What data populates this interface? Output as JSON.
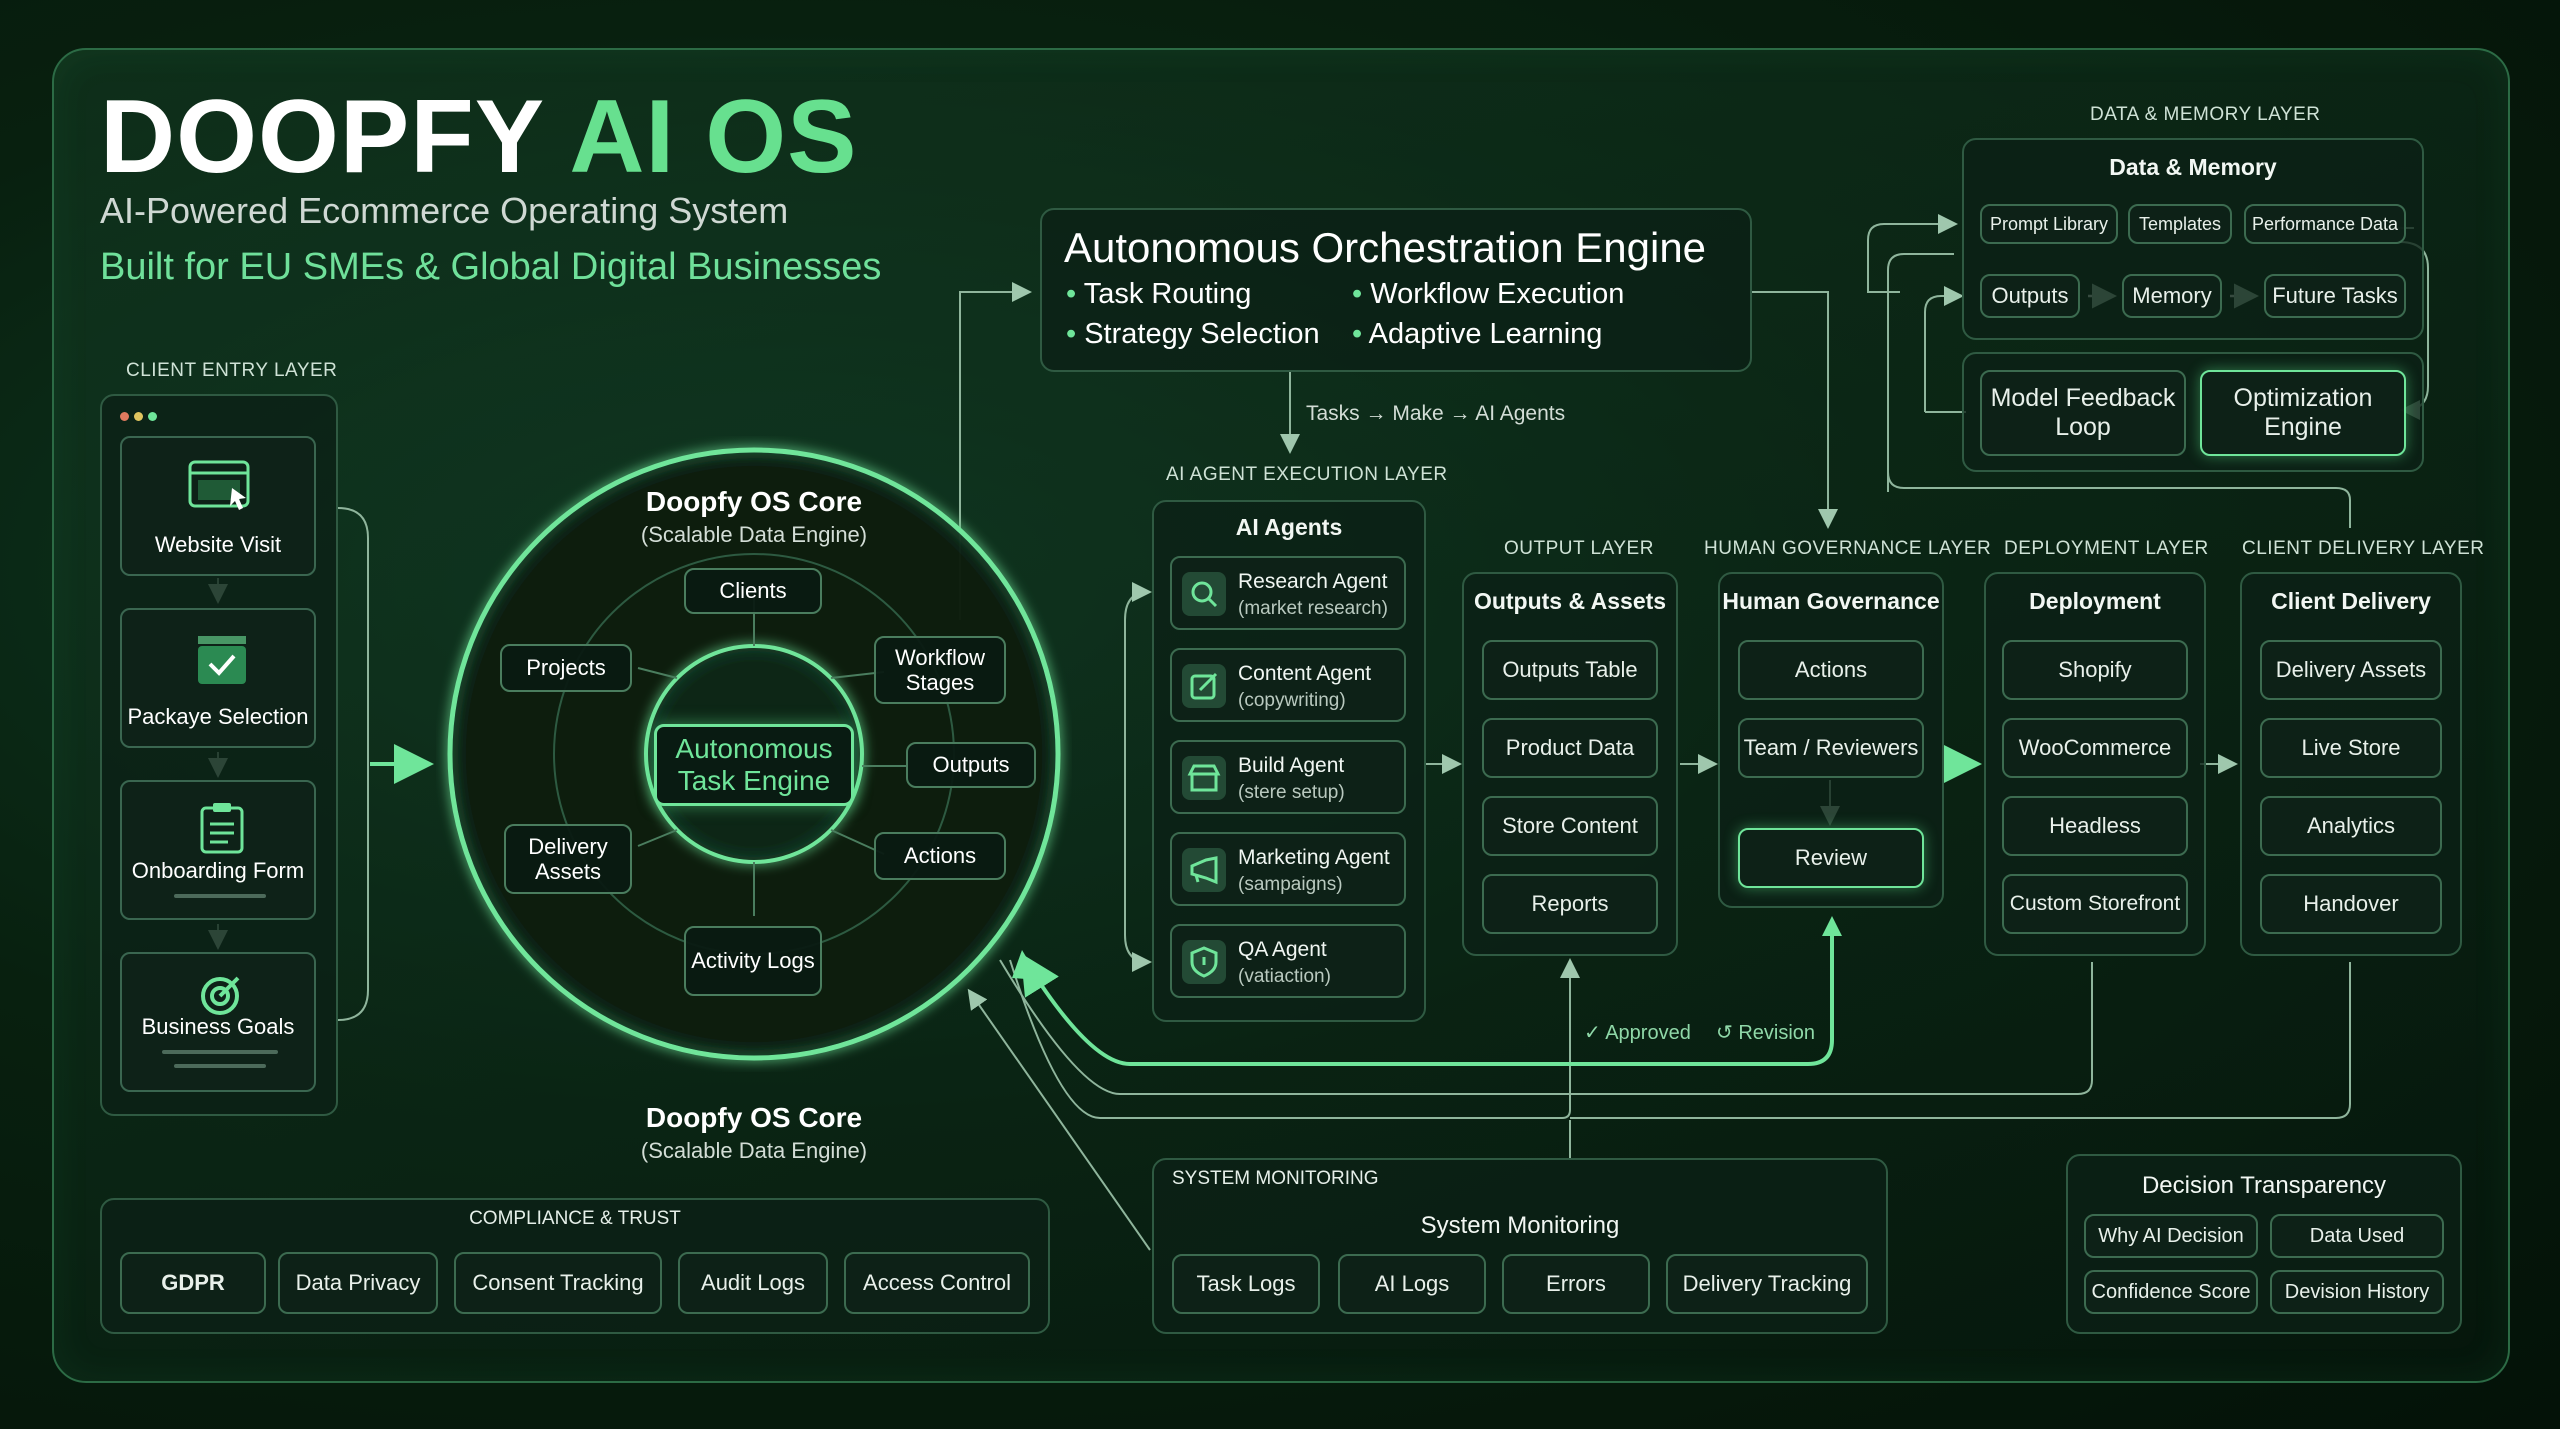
{
  "header": {
    "title_white": "DOOPFY",
    "title_green": "AI OS",
    "subtitle": "AI-Powered Ecommerce Operating System",
    "tagline": "Built for EU SMEs & Global Digital Businesses"
  },
  "client_entry": {
    "layer_label": "CLIENT ENTRY LAYER",
    "items": [
      {
        "label": "Website Visit",
        "icon": "browser-icon"
      },
      {
        "label": "Packaye Selection",
        "icon": "package-check-icon"
      },
      {
        "label": "Onboarding Form",
        "icon": "clipboard-icon"
      },
      {
        "label": "Business Goals",
        "icon": "target-icon"
      }
    ]
  },
  "core": {
    "title": "Doopfy OS Core",
    "subtitle": "(Scalable Data Engine)",
    "center": "Autonomous Task Engine",
    "nodes": [
      "Clients",
      "Workflow Stages",
      "Outputs",
      "Actions",
      "Activity Logs",
      "Delivery Assets",
      "Projects"
    ],
    "bottom_title": "Doopfy OS Core",
    "bottom_subtitle": "(Scalable Data Engine)"
  },
  "orchestration": {
    "title": "Autonomous Orchestration Engine",
    "bullets": [
      "Task Routing",
      "Workflow Execution",
      "Strategy Selection",
      "Adaptive Learning"
    ],
    "flow_label": "Tasks → Make → AI Agents"
  },
  "agents": {
    "layer_label": "AI AGENT EXECUTION LAYER",
    "title": "AI Agents",
    "items": [
      {
        "name": "Research Agent",
        "sub": "(market research)",
        "icon": "search-icon"
      },
      {
        "name": "Content Agent",
        "sub": "(copywriting)",
        "icon": "edit-icon"
      },
      {
        "name": "Build Agent",
        "sub": "(stere setup)",
        "icon": "store-icon"
      },
      {
        "name": "Marketing Agent",
        "sub": "(sampaigns)",
        "icon": "megaphone-icon"
      },
      {
        "name": "QA Agent",
        "sub": "(vatiaction)",
        "icon": "shield-icon"
      }
    ]
  },
  "output_layer": {
    "layer_label": "OUTPUT LAYER",
    "title": "Outputs & Assets",
    "items": [
      "Outputs Table",
      "Product Data",
      "Store Content",
      "Reports"
    ]
  },
  "governance": {
    "layer_label": "HUMAN GOVERNANCE LAYER",
    "title": "Human Governance",
    "items": [
      "Actions",
      "Team / Reviewers",
      "Review"
    ],
    "approved": "Approved",
    "revision": "Revision"
  },
  "deployment": {
    "layer_label": "DEPLOYMENT LAYER",
    "title": "Deployment",
    "items": [
      "Shopify",
      "WooCommerce",
      "Headless",
      "Custom Storefront"
    ]
  },
  "client_delivery": {
    "layer_label": "CLIENT DELIVERY LAYER",
    "title": "Client Delivery",
    "items": [
      "Delivery Assets",
      "Live Store",
      "Analytics",
      "Handover"
    ]
  },
  "data_memory": {
    "layer_label": "DATA & MEMORY LAYER",
    "title": "Data & Memory",
    "row1": [
      "Prompt Library",
      "Templates",
      "Performance Data"
    ],
    "row2": [
      "Outputs",
      "Memory",
      "Future Tasks"
    ],
    "row3": [
      "Model Feedback Loop",
      "Optimization Engine"
    ]
  },
  "compliance": {
    "title": "COMPLIANCE & TRUST",
    "items": [
      "GDPR",
      "Data Privacy",
      "Consent Tracking",
      "Audit Logs",
      "Access Control"
    ]
  },
  "monitoring": {
    "layer_label": "SYSTEM MONITORING",
    "title": "System Monitoring",
    "items": [
      "Task Logs",
      "AI Logs",
      "Errors",
      "Delivery Tracking"
    ]
  },
  "transparency": {
    "title": "Decision Transparency",
    "items": [
      "Why AI Decision",
      "Data Used",
      "Confidence Score",
      "Devision History"
    ]
  },
  "colors": {
    "accent": "#67e08f",
    "background": "#06180d",
    "panel_border": "#2f5a42"
  }
}
